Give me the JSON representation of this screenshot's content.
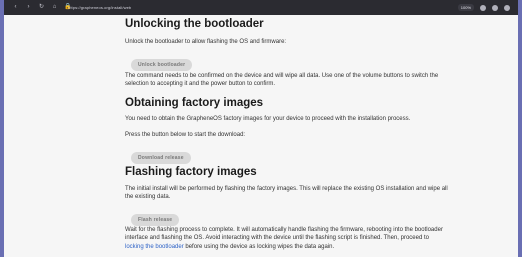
{
  "browser": {
    "url": "https://grapheneos.org/install/web",
    "zoom": "100%"
  },
  "page": {
    "sections": [
      {
        "title": "Unlocking the bootloader",
        "p1": "Unlock the bootloader to allow flashing the OS and firmware:",
        "button": "Unlock bootloader",
        "p2": "The command needs to be confirmed on the device and will wipe all data. Use one of the volume buttons to switch the selection to accepting it and the power button to confirm."
      },
      {
        "title": "Obtaining factory images",
        "p1": "You need to obtain the GrapheneOS factory images for your device to proceed with the installation process.",
        "p2": "Press the button below to start the download:",
        "button": "Download release"
      },
      {
        "title": "Flashing factory images",
        "p1": "The initial install will be performed by flashing the factory images. This will replace the existing OS installation and wipe all the existing data.",
        "button": "Flash release",
        "p2_before_link": "Wait for the flashing process to complete. It will automatically handle flashing the firmware, rebooting into the bootloader interface and flashing the OS. Avoid interacting with the device until the flashing script is finished. Then, proceed to ",
        "link": "locking the bootloader",
        "p2_after_link": " before using the device as locking wipes the data again."
      }
    ]
  }
}
